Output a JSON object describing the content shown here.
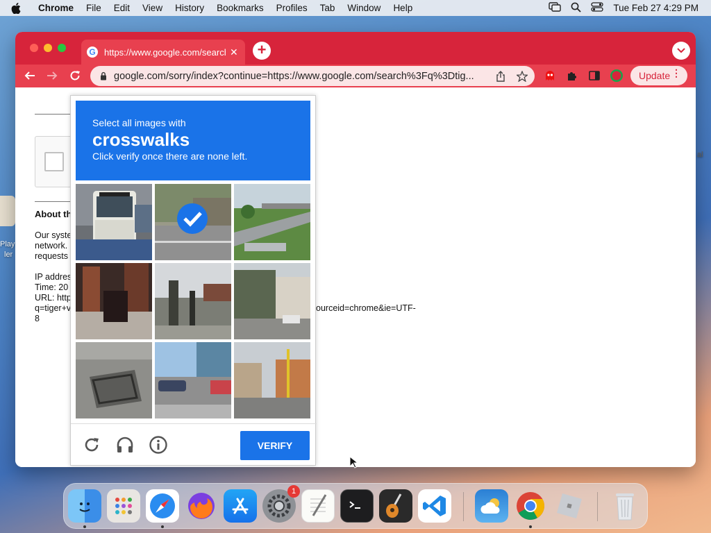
{
  "menubar": {
    "app_name": "Chrome",
    "items": [
      "File",
      "Edit",
      "View",
      "History",
      "Bookmarks",
      "Profiles",
      "Tab",
      "Window",
      "Help"
    ],
    "clock": "Tue Feb 27  4:29 PM"
  },
  "desktop": {
    "fragments": [
      "Play",
      "ler",
      "al"
    ]
  },
  "browser": {
    "tab_title": "https://www.google.com/search?q=tiger",
    "url": "google.com/sorry/index?continue=https://www.google.com/search%3Fq%3Dtig...",
    "update_label": "Update",
    "accent": "#d7243b"
  },
  "page": {
    "about_heading": "About th",
    "lines": [
      "Our syste",
      "network.",
      "requests",
      "IP addres",
      "Time: 20",
      "URL: http",
      "q=tiger+v",
      "8"
    ],
    "url_tail": "ourceid=chrome&ie=UTF-"
  },
  "captcha": {
    "instruction": "Select all images with",
    "target": "crosswalks",
    "hint": "Click verify once there are none left.",
    "verify_label": "VERIFY",
    "header_color": "#1a73e8",
    "tiles": [
      {
        "scene": "bus",
        "selected": false
      },
      {
        "scene": "road-selected",
        "selected": true
      },
      {
        "scene": "interchange",
        "selected": false
      },
      {
        "scene": "dark-interior",
        "selected": false
      },
      {
        "scene": "traffic-light",
        "selected": false
      },
      {
        "scene": "buildings",
        "selected": false
      },
      {
        "scene": "drain-grate",
        "selected": false
      },
      {
        "scene": "intersection",
        "selected": false
      },
      {
        "scene": "street-view",
        "selected": false
      }
    ]
  },
  "dock": {
    "apps": [
      "finder",
      "launchpad",
      "safari",
      "firefox",
      "app-store",
      "system-settings",
      "textedit",
      "terminal",
      "garageband",
      "vscode",
      "weather",
      "chrome",
      "roblox",
      "trash"
    ],
    "settings_badge": "1"
  }
}
